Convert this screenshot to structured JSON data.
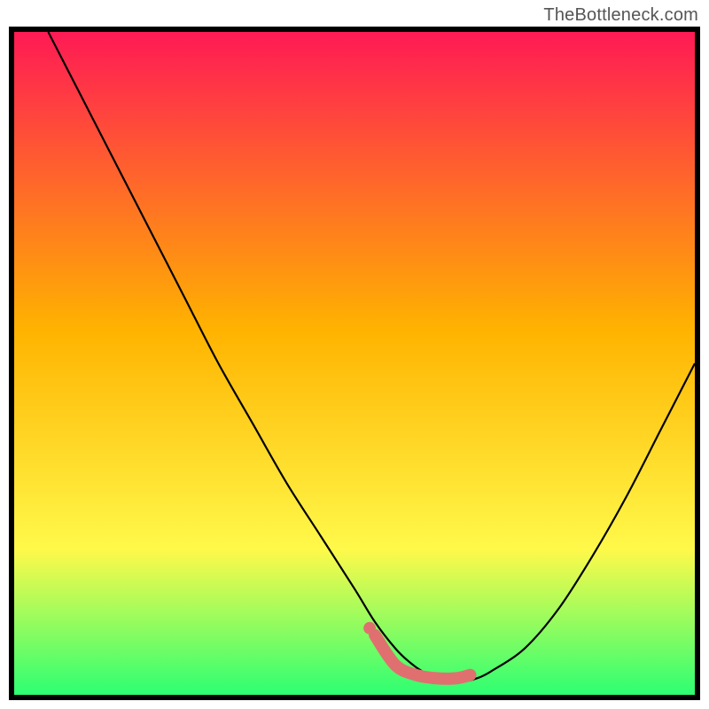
{
  "watermark": "TheBottleneck.com",
  "colors": {
    "gradient_top": "#ff1a55",
    "gradient_mid1": "#ffb300",
    "gradient_mid2": "#fff94a",
    "gradient_bottom": "#2dff73",
    "curve": "#000000",
    "marker": "#e07070",
    "border": "#000000"
  },
  "chart_data": {
    "type": "line",
    "title": "",
    "xlabel": "",
    "ylabel": "",
    "xlim": [
      0,
      100
    ],
    "ylim": [
      0,
      100
    ],
    "series": [
      {
        "name": "curve",
        "x": [
          5,
          10,
          15,
          20,
          25,
          30,
          35,
          40,
          45,
          50,
          53,
          56,
          58,
          60,
          62,
          64,
          66,
          68,
          70,
          75,
          80,
          85,
          90,
          95,
          100
        ],
        "y": [
          100,
          90,
          80,
          70,
          60,
          50,
          41,
          32,
          24,
          16,
          11,
          7,
          5,
          3.5,
          2.5,
          2,
          2,
          2.5,
          3.5,
          7,
          13,
          21,
          30,
          40,
          50
        ]
      }
    ],
    "markers": [
      {
        "name": "highlight-segment",
        "x": [
          53,
          56,
          59,
          62,
          65,
          67
        ],
        "y": [
          9,
          4.5,
          3,
          2.5,
          2.5,
          3
        ]
      }
    ]
  }
}
